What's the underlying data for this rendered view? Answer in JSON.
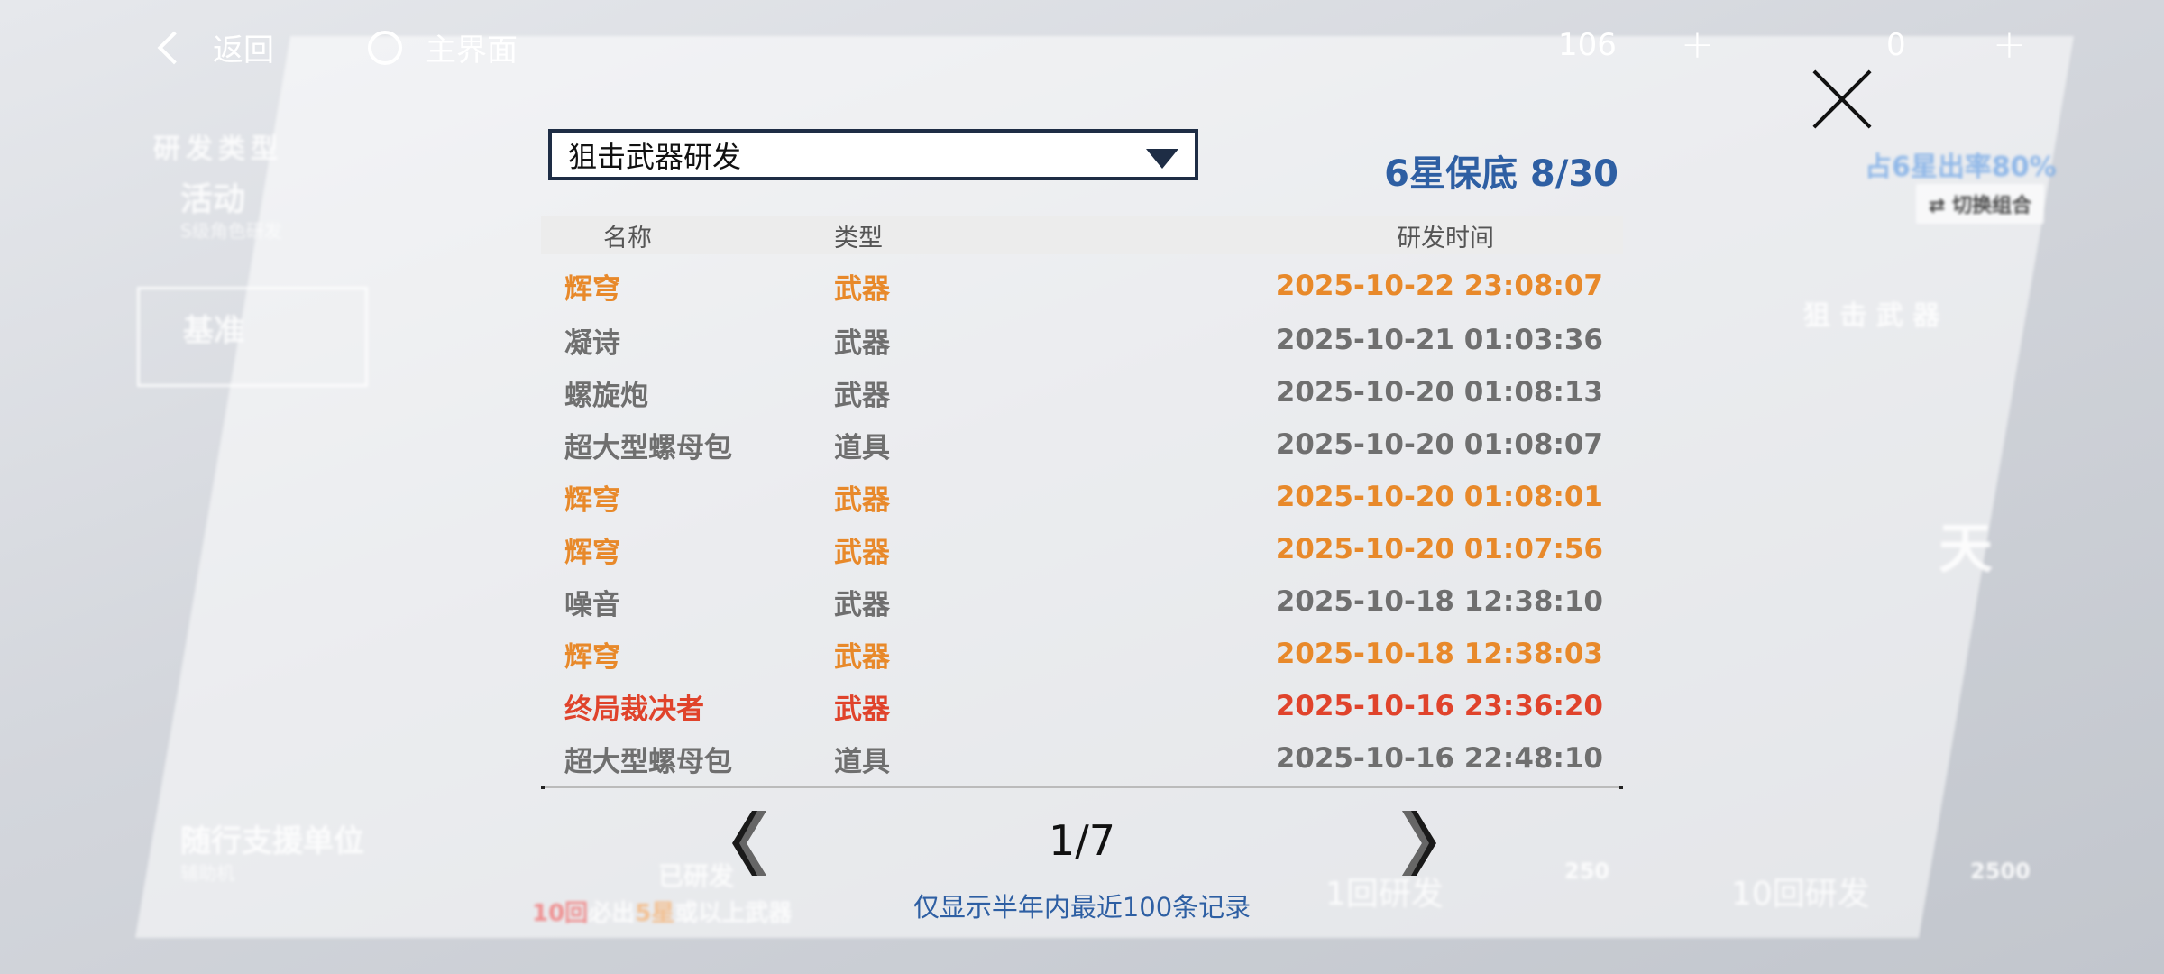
{
  "topbar": {
    "back_label": "返回",
    "home_label": "主界面",
    "resource1_value": "106",
    "resource2_value": "0",
    "plus_label": "+"
  },
  "background": {
    "dev_type_label": "研发类型",
    "activity_label": "活动",
    "activity_sub": "S级角色研发",
    "standard_label": "基准",
    "support_label": "随行支援单位",
    "support_sub": "辅助机",
    "rate_label": "占6星出率80%",
    "switch_label": "切换组合",
    "sniper_label": "狙 击 武 器",
    "day_label": "天",
    "developed_label": "已研发",
    "guarantee_prefix": "10回",
    "guarantee_mid": "必出",
    "guarantee_star": "5星",
    "guarantee_suffix": "或以上武器",
    "btn1_label": "1回研发",
    "btn1_cost": "250",
    "btn10_label": "10回研发",
    "btn10_cost": "2500"
  },
  "modal": {
    "dropdown_value": "狙击武器研发",
    "pity_text": "6星保底 8/30",
    "columns": [
      "名称",
      "类型",
      "研发时间"
    ],
    "rows": [
      {
        "name": "辉穹",
        "type": "武器",
        "time": "2025-10-22 23:08:07",
        "color": "#e8892a"
      },
      {
        "name": "凝诗",
        "type": "武器",
        "time": "2025-10-21 01:03:36",
        "color": "#6f6f6f"
      },
      {
        "name": "螺旋炮",
        "type": "武器",
        "time": "2025-10-20 01:08:13",
        "color": "#6f6f6f"
      },
      {
        "name": "超大型螺母包",
        "type": "道具",
        "time": "2025-10-20 01:08:07",
        "color": "#6f6f6f"
      },
      {
        "name": "辉穹",
        "type": "武器",
        "time": "2025-10-20 01:08:01",
        "color": "#e8892a"
      },
      {
        "name": "辉穹",
        "type": "武器",
        "time": "2025-10-20 01:07:56",
        "color": "#e8892a"
      },
      {
        "name": "噪音",
        "type": "武器",
        "time": "2025-10-18 12:38:10",
        "color": "#6f6f6f"
      },
      {
        "name": "辉穹",
        "type": "武器",
        "time": "2025-10-18 12:38:03",
        "color": "#e8892a"
      },
      {
        "name": "终局裁决者",
        "type": "武器",
        "time": "2025-10-16 23:36:20",
        "color": "#e0432b"
      },
      {
        "name": "超大型螺母包",
        "type": "道具",
        "time": "2025-10-16 22:48:10",
        "color": "#6f6f6f"
      }
    ],
    "page_indicator": "1/7",
    "footer_note": "仅显示半年内最近100条记录"
  }
}
